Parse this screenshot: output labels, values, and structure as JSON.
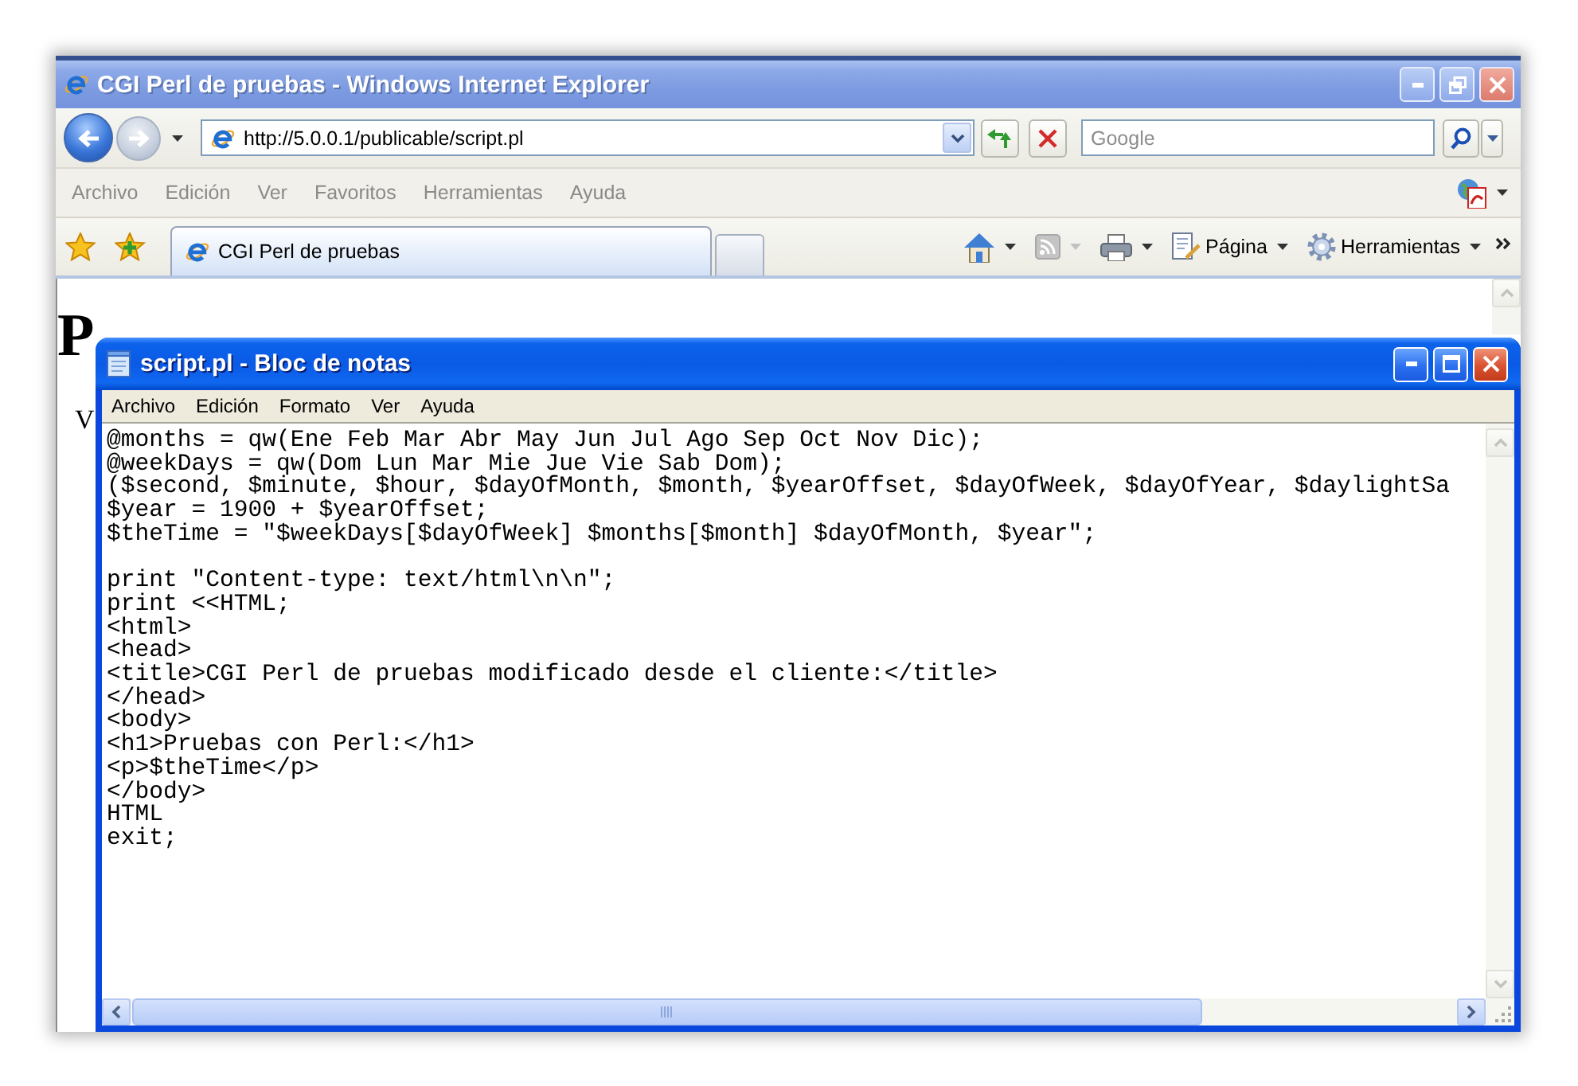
{
  "browser": {
    "title": "CGI Perl de pruebas - Windows Internet Explorer",
    "active": false,
    "maximized": true,
    "nav_buttons": [
      {
        "kind": "back",
        "disabled": false
      },
      {
        "kind": "forward",
        "disabled": true
      }
    ],
    "address": {
      "url": "http://5.0.0.1/publicable/script.pl"
    },
    "search": {
      "placeholder": "Google"
    },
    "menu": [
      "Archivo",
      "Edición",
      "Ver",
      "Favoritos",
      "Herramientas",
      "Ayuda"
    ],
    "tabs": [
      {
        "label": "CGI Perl de pruebas",
        "selected": true
      }
    ],
    "command_bar": [
      {
        "kind": "home",
        "disabled": false
      },
      {
        "kind": "feeds",
        "disabled": true
      },
      {
        "kind": "print",
        "disabled": false
      },
      {
        "kind": "page",
        "label": "Página",
        "disabled": false
      },
      {
        "kind": "tools",
        "label": "Herramientas",
        "disabled": false
      }
    ],
    "page": {
      "heading": "P",
      "paragraph": "V"
    }
  },
  "notepad": {
    "title": "script.pl - Bloc de notas",
    "active": true,
    "maximized": false,
    "menu": [
      "Archivo",
      "Edición",
      "Formato",
      "Ver",
      "Ayuda"
    ],
    "code_blocks": [
      [
        "@months = qw(Ene Feb Mar Abr May Jun Jul Ago Sep Oct Nov Dic);",
        "@weekDays = qw(Dom Lun Mar Mie Jue Vie Sab Dom);",
        "($second, $minute, $hour, $dayOfMonth, $month, $yearOffset, $dayOfWeek, $dayOfYear, $daylightSa",
        "$year = 1900 + $yearOffset;",
        "$theTime = \"$weekDays[$dayOfWeek] $months[$month] $dayOfMonth, $year\";"
      ],
      [
        "print \"Content-type: text/html\\n\\n\";",
        "print <<HTML;",
        "<html>",
        "<head>",
        "<title>CGI Perl de pruebas modificado desde el cliente:</title>",
        "</head>",
        "<body>",
        "<h1>Pruebas con Perl:</h1>",
        "<p>$theTime</p>",
        "</body>",
        "HTML",
        "exit;"
      ]
    ]
  }
}
